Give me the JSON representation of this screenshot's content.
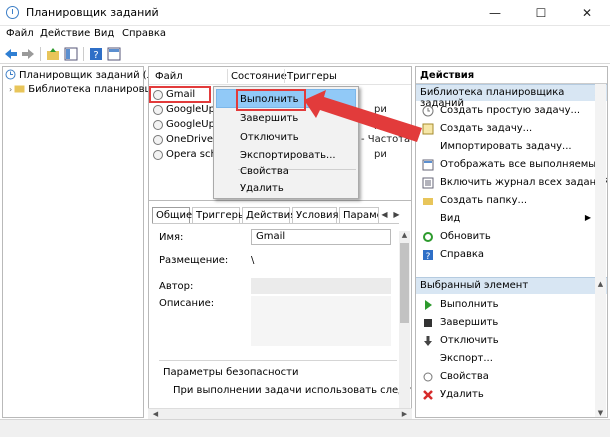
{
  "window": {
    "title": "Планировщик заданий",
    "buttons": {
      "minimize": "—",
      "maximize": "☐",
      "close": "✕"
    }
  },
  "menu": [
    "Файл",
    "Действие",
    "Вид",
    "Справка"
  ],
  "tree": {
    "root": "Планировщик заданий (Лок",
    "library": "Библиотека планировщ"
  },
  "task_list": {
    "columns": [
      "Файл",
      "Состояние",
      "Триггеры"
    ],
    "rows": [
      {
        "name": "Gmail",
        "trigger": ""
      },
      {
        "name": "GoogleUpd",
        "trigger": "ри"
      },
      {
        "name": "GoogleUpd",
        "trigger": "ри"
      },
      {
        "name": "OneDrive St",
        "trigger": "ри"
      },
      {
        "name": "Opera sched",
        "trigger": "ри"
      }
    ],
    "partial_trigger_text": "- Частота по"
  },
  "context_menu": {
    "items": [
      "Выполнить",
      "Завершить",
      "Отключить",
      "Экспортировать...",
      "Свойства",
      "Удалить"
    ],
    "highlighted": "Выполнить"
  },
  "detail": {
    "tabs": [
      "Общие",
      "Триггеры",
      "Действия",
      "Условия",
      "Параметр"
    ],
    "fields": {
      "name_label": "Имя:",
      "name_value": "Gmail",
      "location_label": "Размещение:",
      "location_value": "\\",
      "author_label": "Автор:",
      "description_label": "Описание:"
    },
    "security": {
      "title": "Параметры безопасности",
      "text": "При выполнении задачи использовать следующую у"
    }
  },
  "actions": {
    "title": "Действия",
    "library_section": "Библиотека планировщика заданий",
    "library_items": [
      {
        "label": "Создать простую задачу...",
        "icon": "wand-icon"
      },
      {
        "label": "Создать задачу...",
        "icon": "new-task-icon"
      },
      {
        "label": "Импортировать задачу...",
        "icon": "import-icon"
      },
      {
        "label": "Отображать все выполняемы...",
        "icon": "list-icon"
      },
      {
        "label": "Включить журнал всех заданий",
        "icon": "log-icon"
      },
      {
        "label": "Создать папку...",
        "icon": "folder-icon"
      },
      {
        "label": "Вид",
        "icon": "view-icon",
        "submenu": "▶"
      },
      {
        "label": "Обновить",
        "icon": "refresh-icon"
      },
      {
        "label": "Справка",
        "icon": "help-icon"
      }
    ],
    "selected_section": "Выбранный элемент",
    "selected_items": [
      {
        "label": "Выполнить",
        "icon": "run-icon"
      },
      {
        "label": "Завершить",
        "icon": "stop-icon"
      },
      {
        "label": "Отключить",
        "icon": "disable-icon"
      },
      {
        "label": "Экспорт...",
        "icon": "export-icon"
      },
      {
        "label": "Свойства",
        "icon": "properties-icon"
      },
      {
        "label": "Удалить",
        "icon": "delete-icon"
      }
    ]
  },
  "colors": {
    "accent": "#91c9f7",
    "section": "#d8e6f3",
    "annotation": "#e23b3b"
  }
}
